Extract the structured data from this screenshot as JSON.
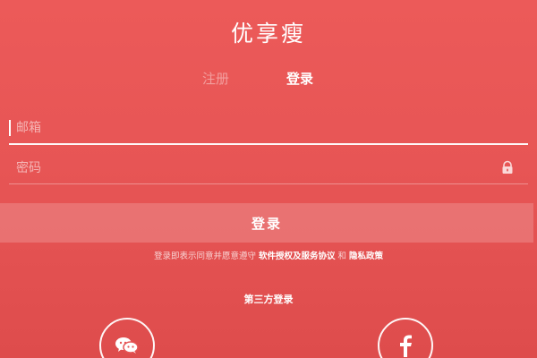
{
  "app": {
    "title": "优享瘦"
  },
  "tabs": {
    "register": "注册",
    "login": "登录"
  },
  "form": {
    "email_placeholder": "邮箱",
    "password_placeholder": "密码",
    "submit_label": "登录"
  },
  "terms": {
    "prefix": "登录即表示同意并愿意遵守 ",
    "software_link": "软件授权及服务协议",
    "middle": " 和 ",
    "privacy_link": "隐私政策"
  },
  "social": {
    "title": "第三方登录",
    "icons": [
      "wechat-icon",
      "facebook-icon"
    ]
  },
  "colors": {
    "background": "#e65454",
    "text": "#ffffff",
    "inactive_tab": "#f4aaaa"
  }
}
